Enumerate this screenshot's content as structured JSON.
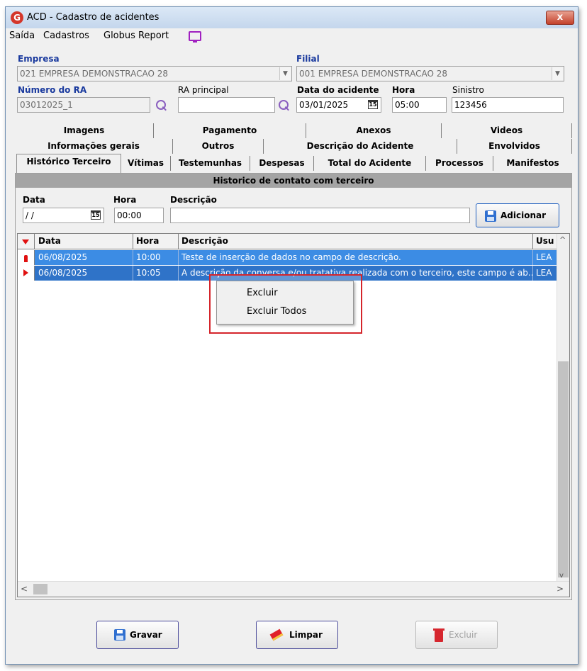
{
  "window": {
    "title": "ACD - Cadastro de acidentes",
    "app_icon": "G",
    "close": "x"
  },
  "menu": {
    "items": [
      "Saída",
      "Cadastros",
      "Globus Report"
    ]
  },
  "form": {
    "empresa_label": "Empresa",
    "empresa_value": "021 EMPRESA DEMONSTRACAO 28",
    "filial_label": "Filial",
    "filial_value": "001 EMPRESA DEMONSTRACAO 28",
    "numero_ra_label": "Número do RA",
    "numero_ra_value": "03012025_1",
    "ra_principal_label": "RA principal",
    "ra_principal_value": "",
    "data_acidente_label": "Data do acidente",
    "data_acidente_value": "03/01/2025",
    "hora_label": "Hora",
    "hora_value": "05:00",
    "sinistro_label": "Sinistro",
    "sinistro_value": "123456"
  },
  "tabs": {
    "row1": [
      "Imagens",
      "Pagamento",
      "Anexos",
      "Videos"
    ],
    "row2": [
      "Informações gerais",
      "Outros",
      "Descrição do Acidente",
      "Envolvidos"
    ],
    "row3": [
      "Histórico Terceiro",
      "Vítimas",
      "Testemunhas",
      "Despesas",
      "Total do Acidente",
      "Processos",
      "Manifestos"
    ]
  },
  "panel": {
    "header": "Historico de contato com terceiro",
    "data_label": "Data",
    "data_value": "/ /",
    "hora_label": "Hora",
    "hora_value": "00:00",
    "descricao_label": "Descrição",
    "descricao_value": "",
    "add_button": "Adicionar"
  },
  "grid": {
    "columns": [
      "Data",
      "Hora",
      "Descrição",
      "Usu"
    ],
    "rows": [
      {
        "data": "06/08/2025",
        "hora": "10:00",
        "descricao": "Teste de inserção de dados no campo de descrição.",
        "usuario": "LEA"
      },
      {
        "data": "06/08/2025",
        "hora": "10:05",
        "descricao": "A descrição da conversa e/ou tratativa realizada com o terceiro, este campo é ab...",
        "usuario": "LEA"
      }
    ]
  },
  "context_menu": {
    "items": [
      "Excluir",
      "Excluir Todos"
    ]
  },
  "buttons": {
    "gravar": "Gravar",
    "limpar": "Limpar",
    "excluir": "Excluir"
  },
  "colors": {
    "selection": "#3c8ce4",
    "selection_dark": "#2f73c8",
    "highlight_box": "#d5252b"
  }
}
